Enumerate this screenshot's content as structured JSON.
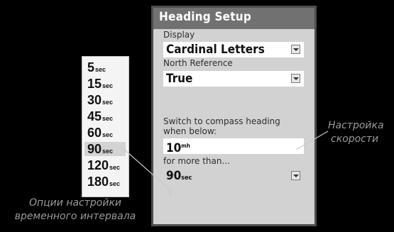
{
  "time_options": [
    {
      "value": "5",
      "unit": "sec"
    },
    {
      "value": "15",
      "unit": "sec"
    },
    {
      "value": "30",
      "unit": "sec"
    },
    {
      "value": "45",
      "unit": "sec"
    },
    {
      "value": "60",
      "unit": "sec"
    },
    {
      "value": "90",
      "unit": "sec",
      "selected": true
    },
    {
      "value": "120",
      "unit": "sec"
    },
    {
      "value": "180",
      "unit": "sec"
    }
  ],
  "screen": {
    "title": "Heading Setup",
    "display_label": "Display",
    "display_value": "Cardinal Letters",
    "north_reference_label": "North Reference",
    "north_reference_value": "True",
    "switch_label_line1": "Switch to compass heading",
    "switch_label_line2": "when below:",
    "speed_value": "10",
    "speed_unit": "mh",
    "duration_label": "for more than...",
    "duration_value": "90",
    "duration_unit": "sec"
  },
  "annotations": {
    "speed_line1": "Настройка",
    "speed_line2": "скорости",
    "time_line1": "Опции настройки",
    "time_line2": "временного интервала"
  }
}
